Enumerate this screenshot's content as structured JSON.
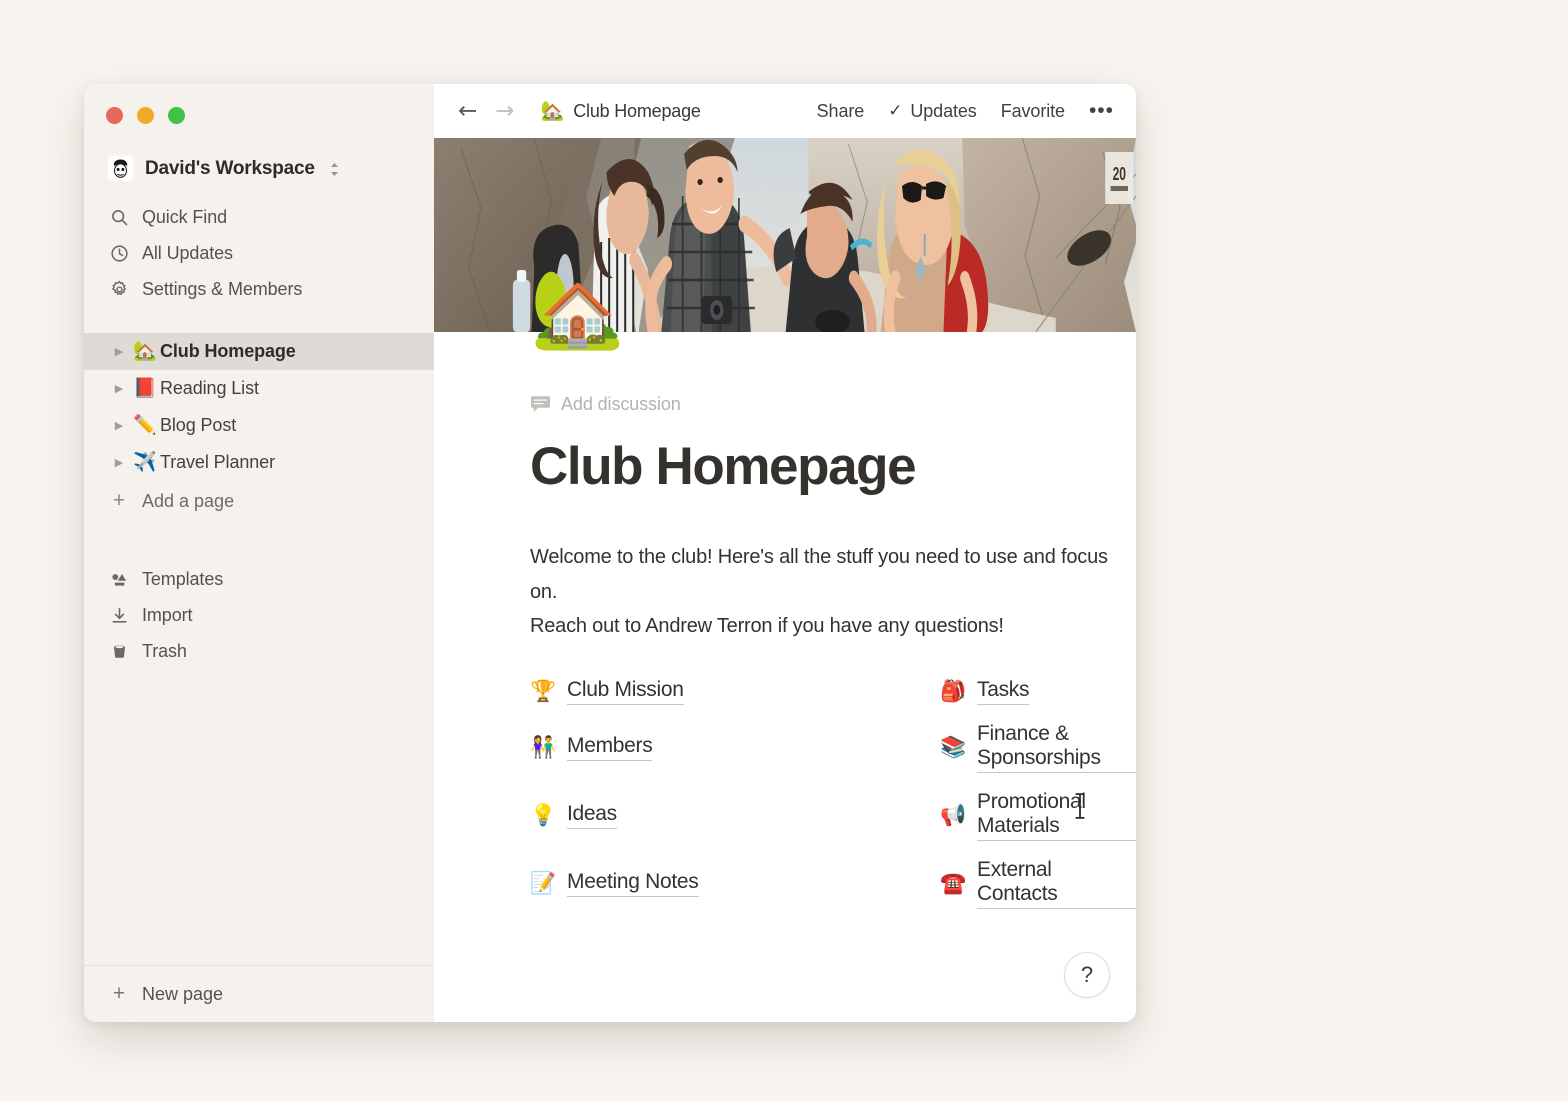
{
  "window": {
    "traffic_lights": [
      {
        "name": "close",
        "color": "#e8685c"
      },
      {
        "name": "minimize",
        "color": "#eeab28"
      },
      {
        "name": "maximize",
        "color": "#3fc246"
      }
    ]
  },
  "sidebar": {
    "workspace": {
      "name": "David's Workspace",
      "avatar_icon": "face-avatar-icon",
      "switcher_icon": "chevron-up-down-icon"
    },
    "nav_items": [
      {
        "label": "Quick Find",
        "icon": "search-icon"
      },
      {
        "label": "All Updates",
        "icon": "clock-icon"
      },
      {
        "label": "Settings & Members",
        "icon": "gear-icon"
      }
    ],
    "pages": [
      {
        "label": "Club Homepage",
        "emoji": "🏡",
        "selected": true
      },
      {
        "label": "Reading List",
        "emoji": "📕",
        "selected": false
      },
      {
        "label": "Blog Post",
        "emoji": "✏️",
        "selected": false
      },
      {
        "label": "Travel Planner",
        "emoji": "✈️",
        "selected": false
      }
    ],
    "add_page_label": "Add a page",
    "tools": [
      {
        "label": "Templates",
        "icon": "templates-icon"
      },
      {
        "label": "Import",
        "icon": "download-icon"
      },
      {
        "label": "Trash",
        "icon": "trash-icon"
      }
    ],
    "new_page_label": "New page"
  },
  "topbar": {
    "back_icon": "arrow-left-icon",
    "forward_icon": "arrow-right-icon",
    "breadcrumb": {
      "emoji": "🏡",
      "label": "Club Homepage"
    },
    "share_label": "Share",
    "updates_label": "Updates",
    "updates_check_icon": "check-icon",
    "favorite_label": "Favorite",
    "more_label": "•••"
  },
  "page": {
    "cover_alt": "Four hikers with backpacks laughing together in a rocky mountain canyon",
    "icon_emoji": "🏡",
    "add_discussion_label": "Add discussion",
    "add_discussion_icon": "comment-icon",
    "title": "Club Homepage",
    "welcome_line_1": "Welcome to the club! Here's all the stuff you need to use and focus on.",
    "welcome_line_2": "Reach out to Andrew Terron if you have any questions!",
    "links": [
      {
        "label": "Club Mission",
        "emoji": "🏆",
        "column": "left"
      },
      {
        "label": "Tasks",
        "emoji": "🎒",
        "column": "right"
      },
      {
        "label": "Members",
        "emoji": "👫",
        "column": "left"
      },
      {
        "label": "Finance & Sponsorships",
        "emoji": "📚",
        "column": "right"
      },
      {
        "label": "Ideas",
        "emoji": "💡",
        "column": "left"
      },
      {
        "label": "Promotional Materials",
        "emoji": "📢",
        "column": "right"
      },
      {
        "label": "Meeting Notes",
        "emoji": "📝",
        "column": "left"
      },
      {
        "label": "External Contacts",
        "emoji": "☎️",
        "column": "right"
      }
    ],
    "help_label": "?"
  },
  "colors": {
    "desktop_bg": "#f8f4ef",
    "sidebar_bg": "#f5f1ed",
    "content_bg": "#ffffff",
    "selected_row": "#dedbd7",
    "text_primary": "#35322e",
    "text_muted": "#b5b1ab"
  }
}
